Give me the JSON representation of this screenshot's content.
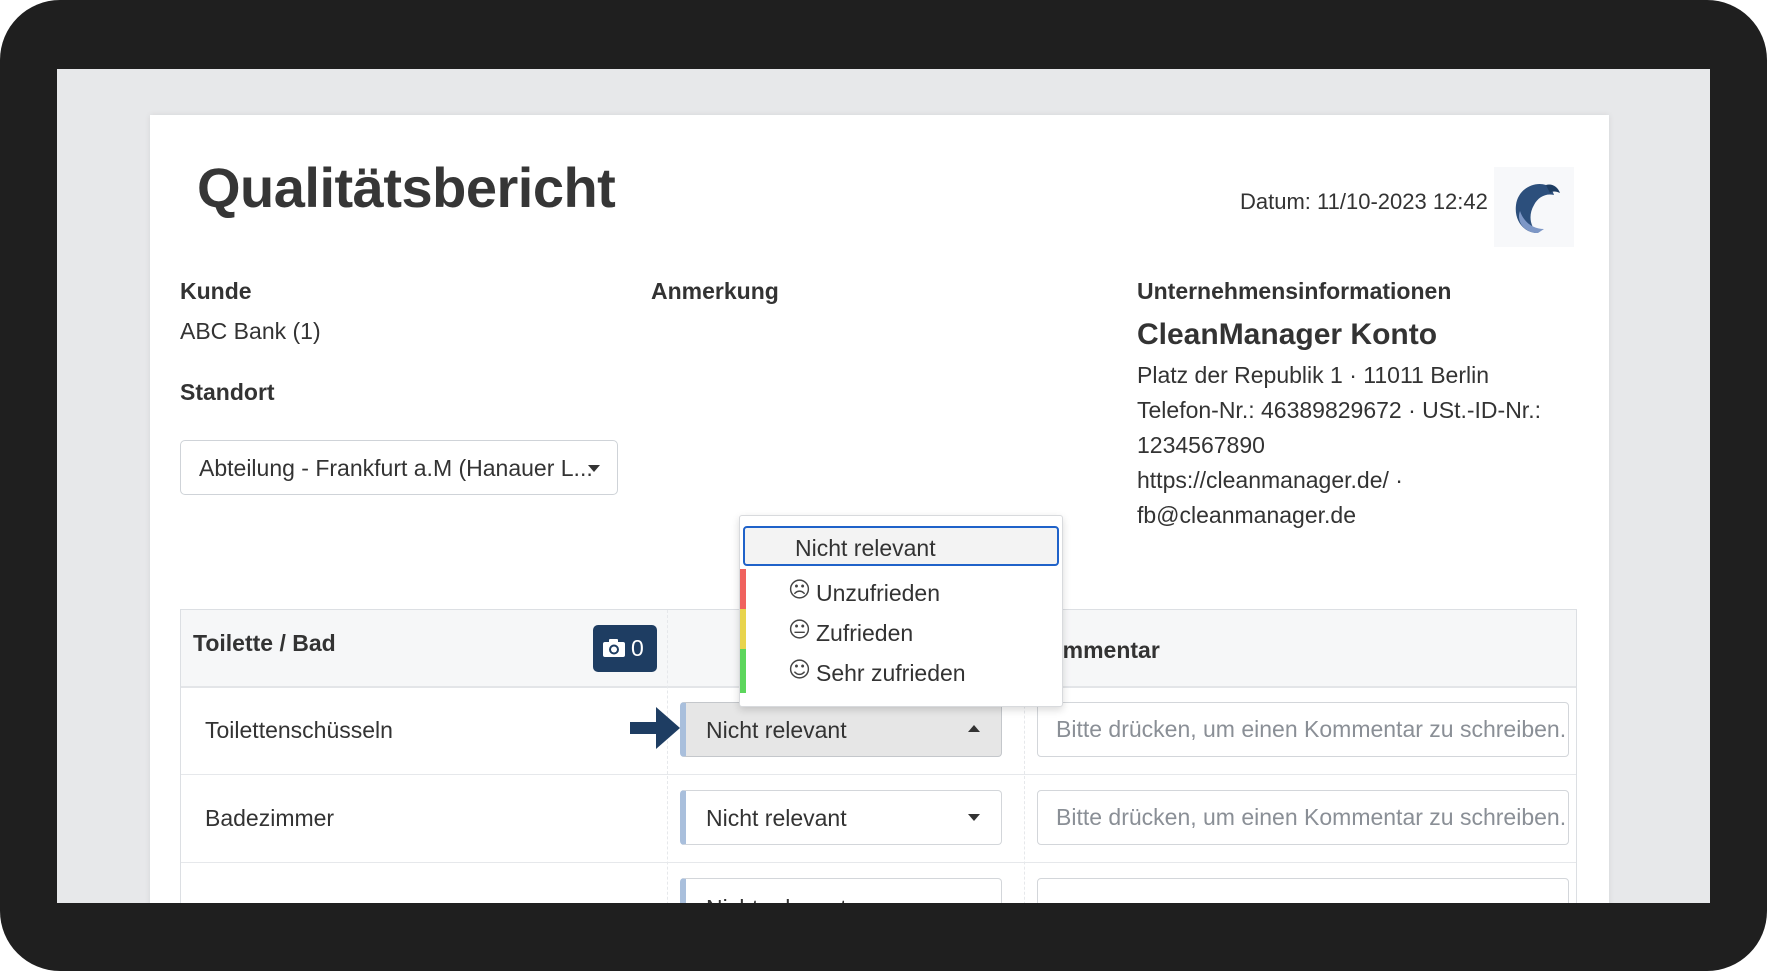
{
  "report": {
    "title": "Qualitätsbericht",
    "date": "Datum: 11/10-2023 12:42"
  },
  "customer": {
    "label": "Kunde",
    "value": "ABC Bank (1)"
  },
  "location": {
    "label": "Standort",
    "selected": "Abteilung - Frankfurt a.M (Hanauer L..."
  },
  "remark": {
    "label": "Anmerkung"
  },
  "company": {
    "label": "Unternehmensinformationen",
    "name": "CleanManager Konto",
    "address": "Platz der Republik 1 · 11011 Berlin",
    "phone_line": "Telefon-Nr.: 46389829672 · USt.-ID-Nr.:",
    "vat": "1234567890",
    "website": "https://cleanmanager.de/ ·",
    "email": "fb@cleanmanager.de"
  },
  "table": {
    "section_header": "Toilette / Bad",
    "photo_count": "0",
    "comment_header": "Kommentar",
    "rows": [
      {
        "name": "Toilettenschüsseln",
        "rating": "Nicht relevant",
        "comment_placeholder": "Bitte drücken, um einen Kommentar zu schreiben..."
      },
      {
        "name": "Badezimmer",
        "rating": "Nicht relevant",
        "comment_placeholder": "Bitte drücken, um einen Kommentar zu schreiben..."
      },
      {
        "name": "",
        "rating": "Nicht relevant",
        "comment_placeholder": ""
      }
    ]
  },
  "rating_dropdown": {
    "options": [
      {
        "label": "Nicht relevant",
        "icon": "none",
        "color": ""
      },
      {
        "label": "Unzufrieden",
        "icon": "frown-icon",
        "color": "#f0625e"
      },
      {
        "label": "Zufrieden",
        "icon": "neutral-face-icon",
        "color": "#e8d44d"
      },
      {
        "label": "Sehr zufrieden",
        "icon": "smile-icon",
        "color": "#5cd65c"
      }
    ],
    "selected": "Nicht relevant"
  },
  "colors": {
    "accent_dark": "#1e3d62",
    "focus_blue": "#1f62c9",
    "rating_bar": "#a9bfdc"
  }
}
